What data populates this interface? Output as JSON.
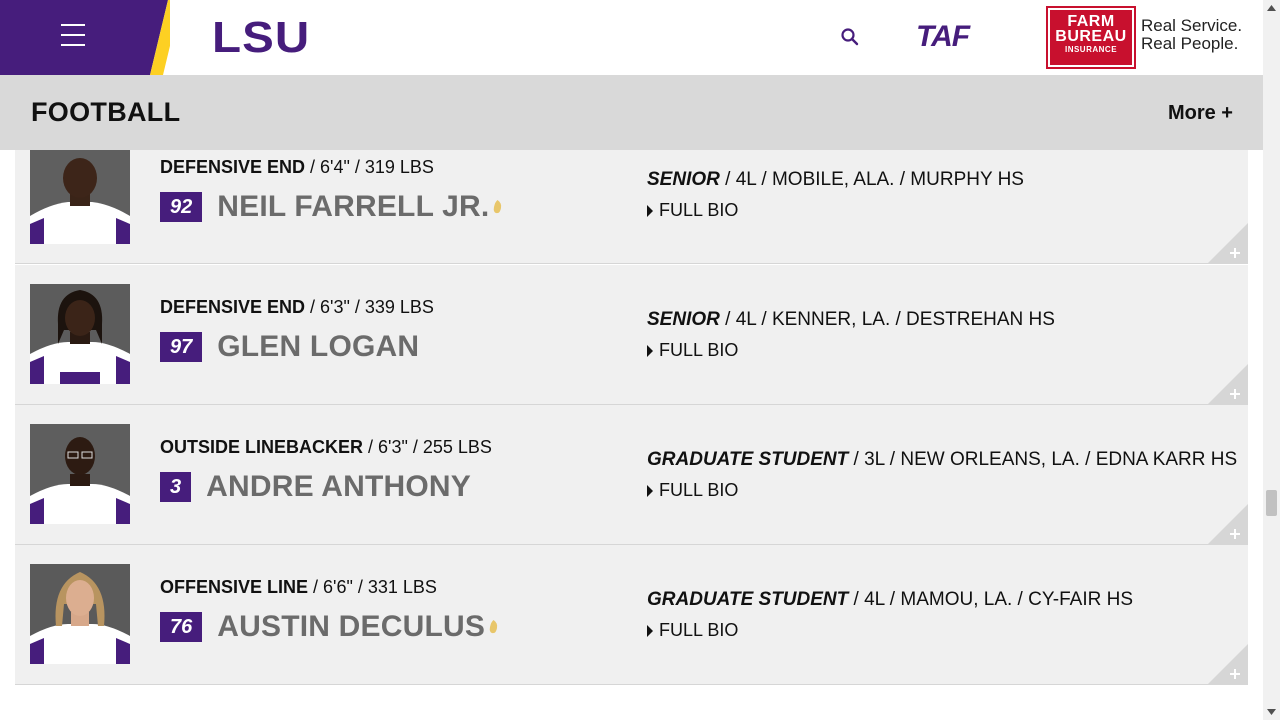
{
  "header": {
    "menu_label": "menu",
    "logo_text": "LSU",
    "sponsor1_text": "TAF",
    "sponsor2_line1": "FARM",
    "sponsor2_line2": "BUREAU",
    "sponsor2_line3": "INSURANCE",
    "sponsor2_tagline1": "Real Service.",
    "sponsor2_tagline2": "Real People.",
    "colors": {
      "purple": "#461d7c",
      "gold": "#fdd023",
      "red": "#c8102e"
    }
  },
  "section": {
    "title": "FOOTBALL",
    "more_label": "More +"
  },
  "players": [
    {
      "position": "DEFENSIVE END",
      "size": " / 6'4\" / 319 LBS",
      "number": "92",
      "name": "NEIL FARRELL JR.",
      "class": "SENIOR",
      "details": " / 4L / MOBILE, ALA. / MURPHY HS",
      "bio_label": "FULL BIO",
      "captain": true
    },
    {
      "position": "DEFENSIVE END",
      "size": " / 6'3\" / 339 LBS",
      "number": "97",
      "name": "GLEN LOGAN",
      "class": "SENIOR",
      "details": " / 4L / KENNER, LA. / DESTREHAN HS",
      "bio_label": "FULL BIO",
      "captain": false
    },
    {
      "position": "OUTSIDE LINEBACKER",
      "size": " / 6'3\" / 255 LBS",
      "number": "3",
      "name": "ANDRE ANTHONY",
      "class": "GRADUATE STUDENT",
      "details": " / 3L / NEW ORLEANS, LA. / EDNA KARR HS",
      "bio_label": "FULL BIO",
      "captain": false
    },
    {
      "position": "OFFENSIVE LINE",
      "size": " / 6'6\" / 331 LBS",
      "number": "76",
      "name": "AUSTIN DECULUS",
      "class": "GRADUATE STUDENT",
      "details": " / 4L / MAMOU, LA. / CY-FAIR HS",
      "bio_label": "FULL BIO",
      "captain": true
    }
  ]
}
